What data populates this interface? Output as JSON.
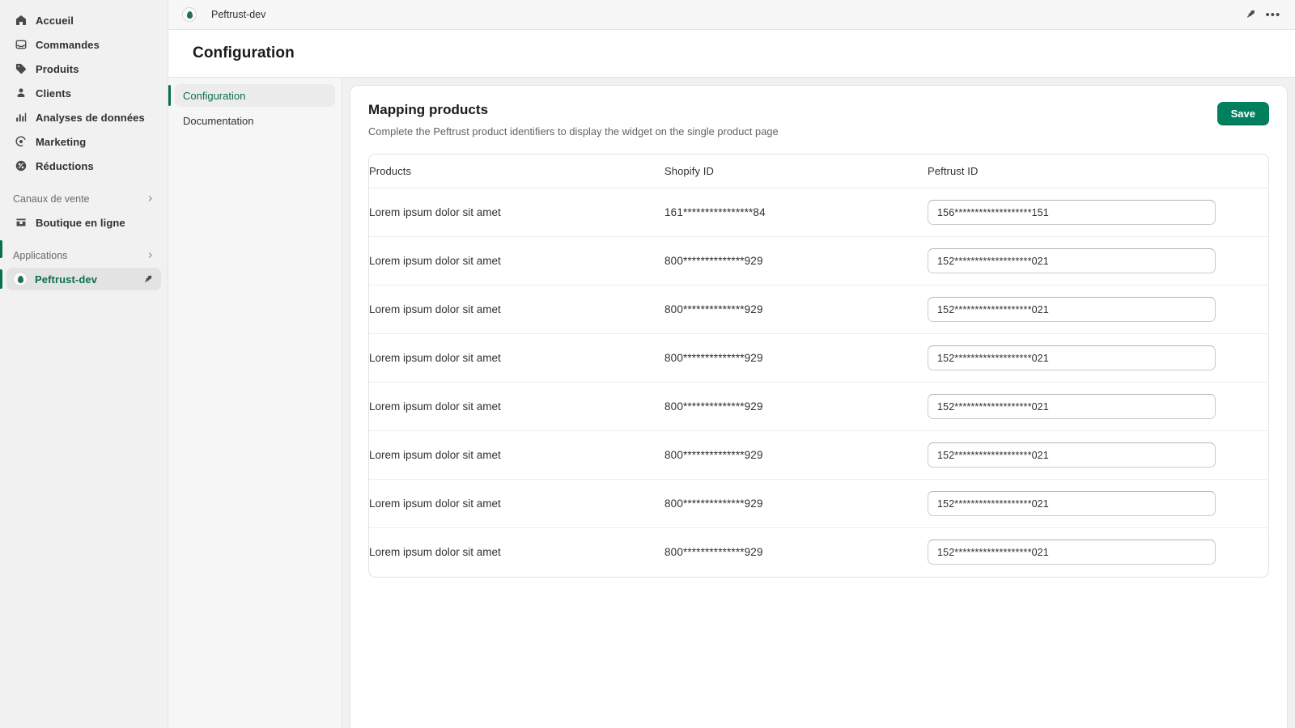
{
  "nav": {
    "items": [
      {
        "label": "Accueil",
        "icon": "home-icon"
      },
      {
        "label": "Commandes",
        "icon": "orders-icon"
      },
      {
        "label": "Produits",
        "icon": "products-tag-icon"
      },
      {
        "label": "Clients",
        "icon": "customers-person-icon"
      },
      {
        "label": "Analyses de données",
        "icon": "analytics-bars-icon"
      },
      {
        "label": "Marketing",
        "icon": "marketing-target-icon"
      },
      {
        "label": "Réductions",
        "icon": "discounts-percent-icon"
      }
    ],
    "sections": [
      {
        "label": "Canaux de vente",
        "chevron": "chevron-right-icon"
      },
      {
        "label": "Applications",
        "chevron": "chevron-right-icon"
      }
    ],
    "sales_channel": {
      "label": "Boutique en ligne",
      "icon": "online-store-icon"
    },
    "app": {
      "label": "Peftrust-dev",
      "pin": "pin-icon"
    },
    "accent_color": "#0a6e52"
  },
  "topbar": {
    "app_name": "Peftrust-dev",
    "pin_label": "pin-icon",
    "more_label": "•••"
  },
  "page": {
    "title": "Configuration"
  },
  "subnav": {
    "items": [
      {
        "label": "Configuration"
      },
      {
        "label": "Documentation"
      }
    ]
  },
  "card": {
    "title": "Mapping products",
    "subtitle": "Complete the Peftrust product identifiers to display the widget on the single product page",
    "save_label": "Save",
    "save_color": "#00805e"
  },
  "table": {
    "headers": {
      "products": "Products",
      "shopify_id": "Shopify ID",
      "peftrust_id": "Peftrust ID"
    },
    "rows": [
      {
        "product": "Lorem ipsum dolor sit amet",
        "shopify_id": "161****************84",
        "peftrust_id": "156*******************151"
      },
      {
        "product": "Lorem ipsum dolor sit amet",
        "shopify_id": "800**************929",
        "peftrust_id": "152*******************021"
      },
      {
        "product": "Lorem ipsum dolor sit amet",
        "shopify_id": "800**************929",
        "peftrust_id": "152*******************021"
      },
      {
        "product": "Lorem ipsum dolor sit amet",
        "shopify_id": "800**************929",
        "peftrust_id": "152*******************021"
      },
      {
        "product": "Lorem ipsum dolor sit amet",
        "shopify_id": "800**************929",
        "peftrust_id": "152*******************021"
      },
      {
        "product": "Lorem ipsum dolor sit amet",
        "shopify_id": "800**************929",
        "peftrust_id": "152*******************021"
      },
      {
        "product": "Lorem ipsum dolor sit amet",
        "shopify_id": "800**************929",
        "peftrust_id": "152*******************021"
      },
      {
        "product": "Lorem ipsum dolor sit amet",
        "shopify_id": "800**************929",
        "peftrust_id": "152*******************021"
      }
    ]
  }
}
